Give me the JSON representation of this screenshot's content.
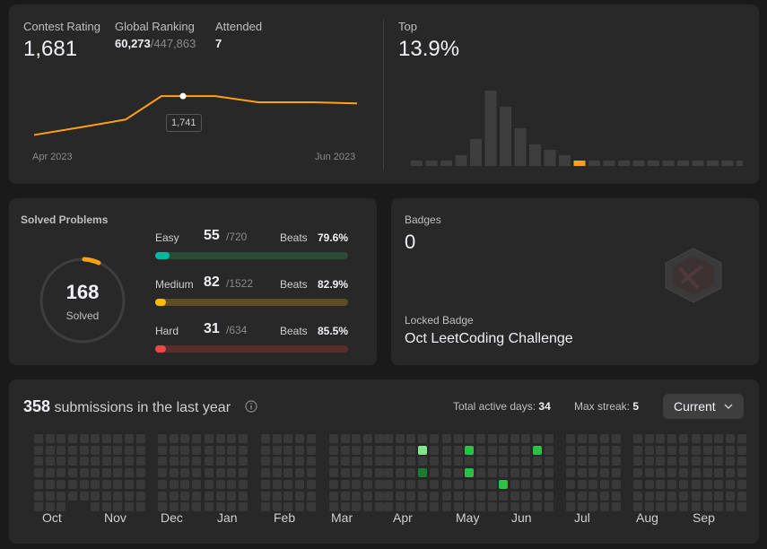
{
  "contest": {
    "rating_label": "Contest Rating",
    "rating_value": "1,681",
    "global_label": "Global Ranking",
    "global_rank": "60,273",
    "global_total": "/447,863",
    "attended_label": "Attended",
    "attended_value": "7",
    "top_label": "Top",
    "top_value": "13.9%",
    "tooltip_value": "1,741",
    "x_start": "Apr 2023",
    "x_end": "Jun 2023",
    "line_color": "#ffa116",
    "rating_series": [
      1640,
      1660,
      1680,
      1741,
      1741,
      1741,
      1725,
      1725,
      1722
    ],
    "histogram": [
      2,
      2,
      2,
      4,
      10,
      28,
      22,
      14,
      8,
      6,
      4,
      2,
      2,
      2,
      2,
      2,
      2,
      2,
      2,
      2,
      2,
      2,
      2,
      2
    ],
    "histogram_highlight_index": 11
  },
  "solved": {
    "title": "Solved Problems",
    "total": "168",
    "total_label": "Solved",
    "rows": [
      {
        "name": "Easy",
        "count": "55",
        "total": "/720",
        "beats_label": "Beats",
        "beats": "79.6%",
        "fraction": 0.076,
        "color": "#00b8a3",
        "track": "#2a4d37"
      },
      {
        "name": "Medium",
        "count": "82",
        "total": "/1522",
        "beats_label": "Beats",
        "beats": "82.9%",
        "fraction": 0.054,
        "color": "#ffb800",
        "track": "#5e4e23"
      },
      {
        "name": "Hard",
        "count": "31",
        "total": "/634",
        "beats_label": "Beats",
        "beats": "85.5%",
        "fraction": 0.049,
        "color": "#ef4743",
        "track": "#5a2c2c"
      }
    ]
  },
  "badges": {
    "title": "Badges",
    "count": "0",
    "locked_label": "Locked Badge",
    "locked_name": "Oct LeetCoding Challenge"
  },
  "heatmap": {
    "count": "358",
    "title_text": "submissions in the last year",
    "active_label": "Total active days:",
    "active_value": "34",
    "streak_label": "Max streak:",
    "streak_value": "5",
    "dropdown_value": "Current",
    "months": [
      "Oct",
      "Nov",
      "Dec",
      "Jan",
      "Feb",
      "Mar",
      "Apr",
      "May",
      "Jun",
      "Jul",
      "Aug",
      "Sep"
    ],
    "colors": {
      "empty": "#393939",
      "l1": "#0e4429",
      "l2": "#1a7d33",
      "l3": "#28c244",
      "l4": "#7ee787"
    }
  }
}
